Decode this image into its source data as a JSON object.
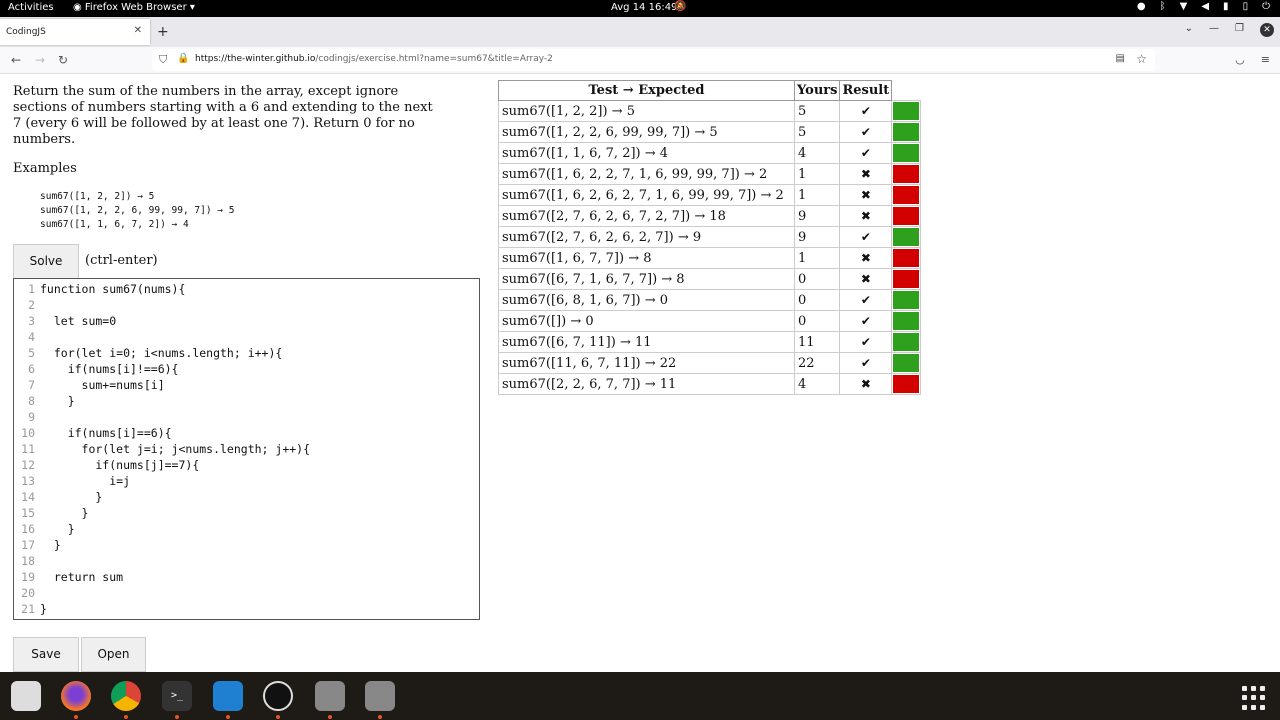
{
  "system": {
    "activities": "Activities",
    "app_menu": "Firefox Web Browser",
    "clock": "Avg 14  16:49"
  },
  "browser": {
    "tab_title": "CodingJS",
    "url_host": "https://the-winter.github.io",
    "url_path": "/codingjs/exercise.html?name=sum67&title=Array-2"
  },
  "exercise": {
    "description": "Return the sum of the numbers in the array, except ignore sections of numbers starting with a 6 and extending to the next 7 (every 6 will be followed by at least one 7). Return 0 for no numbers.",
    "examples_title": "Examples",
    "examples": [
      "sum67([1, 2, 2]) → 5",
      "sum67([1, 2, 2, 6, 99, 99, 7]) → 5",
      "sum67([1, 1, 6, 7, 2]) → 4"
    ],
    "solve_label": "Solve",
    "solve_hint": "(ctrl-enter)",
    "save_label": "Save",
    "open_label": "Open"
  },
  "editor": {
    "lines": [
      "function sum67(nums){",
      "",
      "  let sum=0",
      "",
      "  for(let i=0; i<nums.length; i++){",
      "    if(nums[i]!==6){",
      "      sum+=nums[i]",
      "    }",
      "",
      "    if(nums[i]==6){",
      "      for(let j=i; j<nums.length; j++){",
      "        if(nums[j]==7){",
      "          i=j",
      "        }",
      "      }",
      "    }",
      "  }",
      "",
      "  return sum",
      "",
      "}"
    ]
  },
  "results": {
    "headers": {
      "test": "Test → Expected",
      "yours": "Yours",
      "result": "Result"
    },
    "pass_color": "#2ea01e",
    "fail_color": "#d30000",
    "rows": [
      {
        "test": "sum67([1, 2, 2]) → 5",
        "yours": "5",
        "pass": true
      },
      {
        "test": "sum67([1, 2, 2, 6, 99, 99, 7]) → 5",
        "yours": "5",
        "pass": true
      },
      {
        "test": "sum67([1, 1, 6, 7, 2]) → 4",
        "yours": "4",
        "pass": true
      },
      {
        "test": "sum67([1, 6, 2, 2, 7, 1, 6, 99, 99, 7]) → 2",
        "yours": "1",
        "pass": false
      },
      {
        "test": "sum67([1, 6, 2, 6, 2, 7, 1, 6, 99, 99, 7]) → 2",
        "yours": "1",
        "pass": false
      },
      {
        "test": "sum67([2, 7, 6, 2, 6, 7, 2, 7]) → 18",
        "yours": "9",
        "pass": false
      },
      {
        "test": "sum67([2, 7, 6, 2, 6, 2, 7]) → 9",
        "yours": "9",
        "pass": true
      },
      {
        "test": "sum67([1, 6, 7, 7]) → 8",
        "yours": "1",
        "pass": false
      },
      {
        "test": "sum67([6, 7, 1, 6, 7, 7]) → 8",
        "yours": "0",
        "pass": false
      },
      {
        "test": "sum67([6, 8, 1, 6, 7]) → 0",
        "yours": "0",
        "pass": true
      },
      {
        "test": "sum67([]) → 0",
        "yours": "0",
        "pass": true
      },
      {
        "test": "sum67([6, 7, 11]) → 11",
        "yours": "11",
        "pass": true
      },
      {
        "test": "sum67([11, 6, 7, 11]) → 22",
        "yours": "22",
        "pass": true
      },
      {
        "test": "sum67([2, 2, 6, 7, 7]) → 11",
        "yours": "4",
        "pass": false
      }
    ],
    "pass_mark": "✔",
    "fail_mark": "✖"
  }
}
